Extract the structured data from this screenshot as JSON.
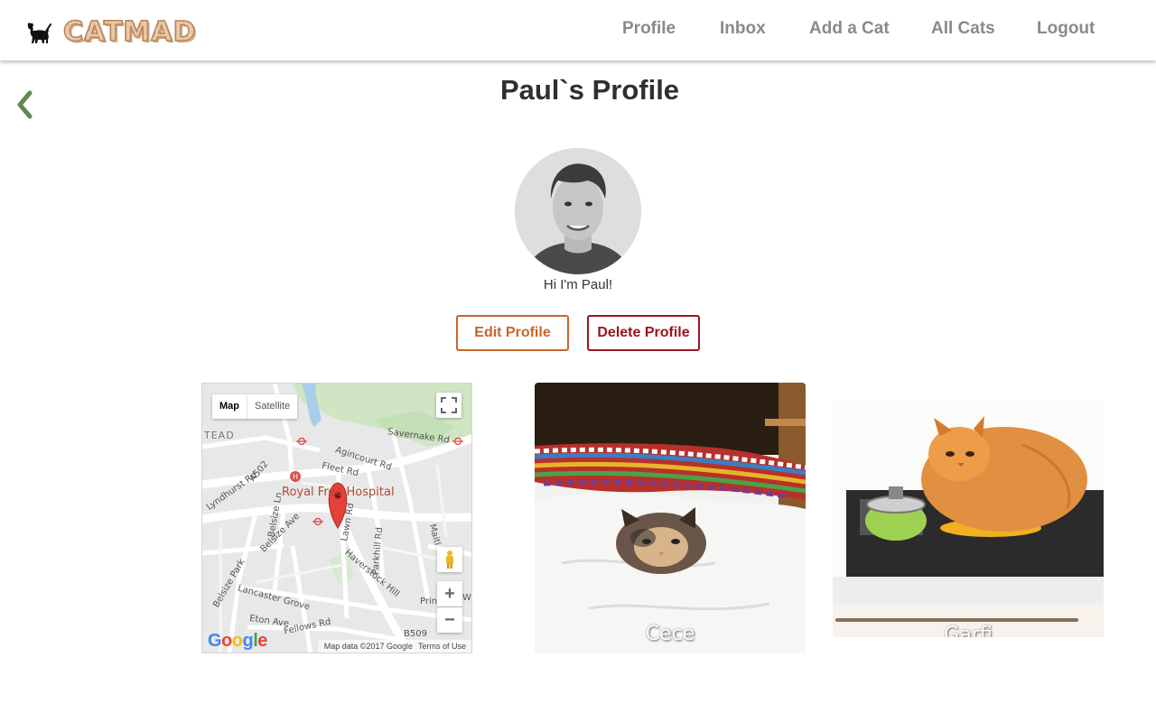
{
  "brand": {
    "name": "CATMAD",
    "logo_icon": "cat-silhouette-icon"
  },
  "nav": {
    "items": [
      {
        "label": "Profile"
      },
      {
        "label": "Inbox"
      },
      {
        "label": "Add a Cat"
      },
      {
        "label": "All Cats"
      },
      {
        "label": "Logout"
      }
    ]
  },
  "page": {
    "back_icon": "chevron-left-icon",
    "title": "Paul`s Profile"
  },
  "profile": {
    "bio": "Hi I'm Paul!",
    "edit_label": "Edit Profile",
    "delete_label": "Delete Profile"
  },
  "map": {
    "type_map": "Map",
    "type_satellite": "Satellite",
    "zoom_in": "+",
    "zoom_out": "−",
    "logo": "Google",
    "attribution": "Map data ©2017 Google",
    "terms": "Terms of Use",
    "labels": {
      "tead": "TEAD",
      "savernake": "Savernake Rd",
      "agincourt": "Agincourt Rd",
      "fleet": "Fleet Rd",
      "a502": "A502",
      "lyndhurst": "Lyndhurst Rd",
      "hospital": "Royal Free Hospital",
      "belsize_ln": "Belsize Ln",
      "belsize_ave": "Belsize Ave",
      "lawn": "Lawn Rd",
      "maitland": "Maitl",
      "parkhill": "Parkhill Rd",
      "haverstock": "Haverstock Hill",
      "belsize_park": "Belsize Park",
      "lancaster": "Lancaster Grove",
      "eton": "Eton Ave",
      "fellows": "Fellows Rd",
      "b509": "B509",
      "prince": "Prin",
      "w": "W"
    }
  },
  "cats": [
    {
      "name": "Cece"
    },
    {
      "name": "Garfi"
    }
  ],
  "colors": {
    "nav_text": "#8a8a8a",
    "edit_accent": "#c8642a",
    "delete_accent": "#9b1420",
    "back_chevron": "#5f8a4e"
  }
}
